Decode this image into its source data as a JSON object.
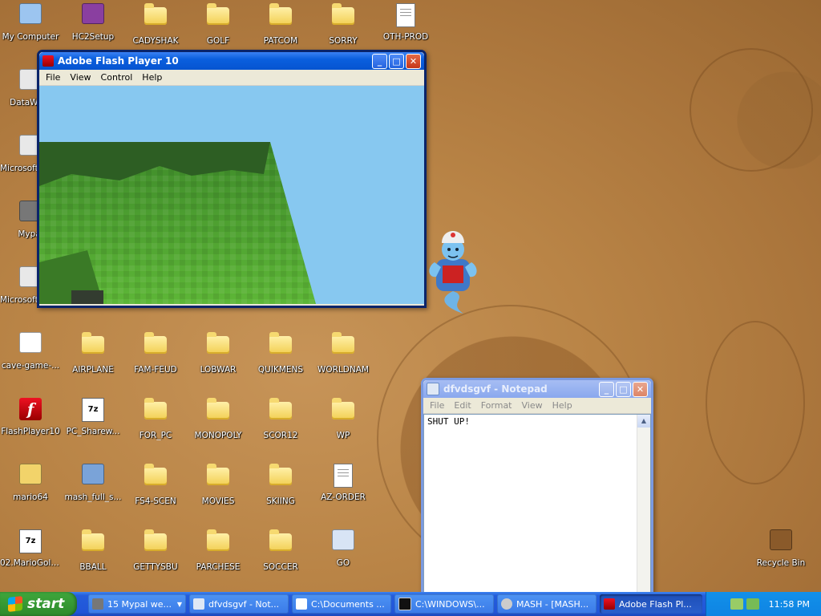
{
  "desktop": {
    "icons": [
      {
        "label": "My Computer",
        "icon": "computer-icon"
      },
      {
        "label": "HC2Setup",
        "icon": "archive-icon"
      },
      {
        "label": "CADYSHAK",
        "icon": "folder-icon"
      },
      {
        "label": "GOLF",
        "icon": "folder-icon"
      },
      {
        "label": "PATCOM",
        "icon": "folder-icon"
      },
      {
        "label": "SORRY",
        "icon": "folder-icon"
      },
      {
        "label": "OTH-PROD",
        "icon": "document-icon"
      },
      {
        "label": "DataWare",
        "icon": "shortcut-icon"
      },
      {
        "label": "Microsoft Visual C++",
        "icon": "shortcut-icon"
      },
      {
        "label": "Mypal",
        "icon": "raccoon-icon"
      },
      {
        "label": "Microsoft Visual Basic 6.0",
        "icon": "shortcut-icon"
      },
      {
        "label": "cave-game-...",
        "icon": "media-icon"
      },
      {
        "label": "AIRPLANE",
        "icon": "folder-icon"
      },
      {
        "label": "FAM-FEUD",
        "icon": "folder-icon"
      },
      {
        "label": "LOBWAR",
        "icon": "folder-icon"
      },
      {
        "label": "QUIKMENS",
        "icon": "folder-icon"
      },
      {
        "label": "WORLDNAM",
        "icon": "folder-icon"
      },
      {
        "label": "FlashPlayer10",
        "icon": "flash-icon"
      },
      {
        "label": "PC_Sharew...",
        "icon": "7z-icon"
      },
      {
        "label": "FOR_PC",
        "icon": "folder-icon"
      },
      {
        "label": "MONOPOLY",
        "icon": "folder-icon"
      },
      {
        "label": "SCOR12",
        "icon": "folder-icon"
      },
      {
        "label": "WP",
        "icon": "folder-icon"
      },
      {
        "label": "mario64",
        "icon": "zip-icon"
      },
      {
        "label": "mash_full_s...",
        "icon": "installer-icon"
      },
      {
        "label": "FS4-SCEN",
        "icon": "folder-icon"
      },
      {
        "label": "MOVIES",
        "icon": "folder-icon"
      },
      {
        "label": "SKIING",
        "icon": "folder-icon"
      },
      {
        "label": "AZ-ORDER",
        "icon": "file-icon"
      },
      {
        "label": "02.MarioGold2",
        "icon": "7z-icon"
      },
      {
        "label": "BBALL",
        "icon": "folder-icon"
      },
      {
        "label": "GETTYSBU",
        "icon": "folder-icon"
      },
      {
        "label": "PARCHESE",
        "icon": "folder-icon"
      },
      {
        "label": "SOCCER",
        "icon": "folder-icon"
      },
      {
        "label": "GO",
        "icon": "program-icon"
      },
      {
        "label": "Recycle Bin",
        "icon": "recycle-bin-icon"
      }
    ]
  },
  "flash_window": {
    "title": "Adobe Flash Player 10",
    "menu": [
      "File",
      "View",
      "Control",
      "Help"
    ],
    "sky_color": "#87c8f0",
    "grass_color": "#4fa52c"
  },
  "notepad_window": {
    "title": "dfvdsgvf - Notepad",
    "menu": [
      "File",
      "Edit",
      "Format",
      "View",
      "Help"
    ],
    "content": "SHUT UP!"
  },
  "taskbar": {
    "start_label": "start",
    "tasks": [
      {
        "label": "15 Mypal we...",
        "icon": "raccoon-icon",
        "count": "15"
      },
      {
        "label": "dfvdsgvf - Not...",
        "icon": "notepad-icon"
      },
      {
        "label": "C:\\Documents ...",
        "icon": "7z-icon"
      },
      {
        "label": "C:\\WINDOWS\\...",
        "icon": "cmd-icon"
      },
      {
        "label": "MASH - [MASH...",
        "icon": "mash-icon"
      },
      {
        "label": "Adobe Flash Pl...",
        "icon": "flash-icon",
        "active": true
      }
    ],
    "clock": "11:58 PM"
  }
}
